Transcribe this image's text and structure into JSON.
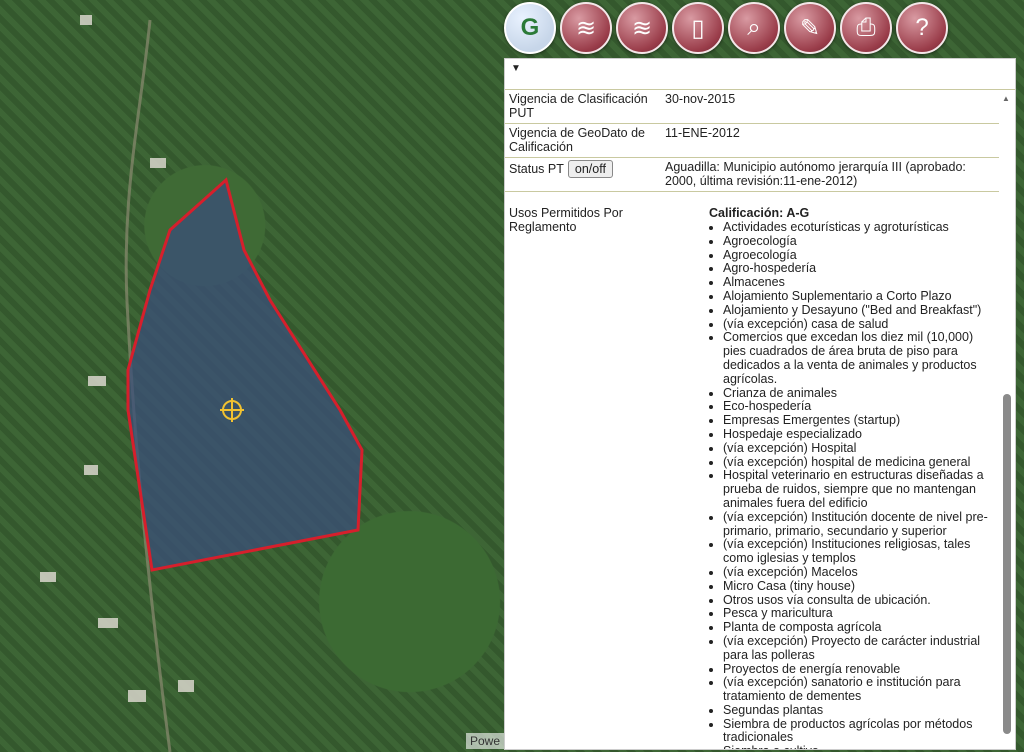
{
  "toolbar": {
    "items": [
      {
        "name": "google-maps-icon",
        "glyph": "G"
      },
      {
        "name": "layers-icon",
        "glyph": "≋"
      },
      {
        "name": "layers-stack-icon",
        "glyph": "≋"
      },
      {
        "name": "mobile-icon",
        "glyph": "▯"
      },
      {
        "name": "search-icon",
        "glyph": "⌕"
      },
      {
        "name": "edit-icon",
        "glyph": "✎"
      },
      {
        "name": "print-icon",
        "glyph": "⎙"
      },
      {
        "name": "help-icon",
        "glyph": "?"
      }
    ]
  },
  "panel": {
    "caret": "▼",
    "rows": [
      {
        "label": "Vigencia de Clasificación PUT",
        "value": "30-nov-2015"
      },
      {
        "label": "Vigencia de GeoDato de Calificación",
        "value": "11-ENE-2012"
      }
    ],
    "status": {
      "label": "Status PT",
      "button": "on/off",
      "value": "Aguadilla: Municipio autónomo jerarquía III (aprobado: 2000, última revisión:11-ene-2012)"
    },
    "usos": {
      "label": "Usos Permitidos Por Reglamento",
      "heading": "Calificación: A-G",
      "items": [
        "Actividades ecoturísticas y agroturísticas",
        "Agroecología",
        "Agroecología",
        "Agro-hospedería",
        "Almacenes",
        "Alojamiento Suplementario a Corto Plazo",
        "Alojamiento y Desayuno (\"Bed and Breakfast\")",
        "(vía excepción) casa de salud",
        "Comercios que excedan los diez mil (10,000) pies cuadrados de área bruta de piso para dedicados a la venta de animales y productos agrícolas.",
        "Crianza de animales",
        "Eco-hospedería",
        "Empresas Emergentes (startup)",
        "Hospedaje especializado",
        "(vía excepción) Hospital",
        "(vía excepción) hospital de medicina general",
        "Hospital veterinario en estructuras diseñadas a prueba de ruidos, siempre que no mantengan animales fuera del edificio",
        "(vía excepción) Institución docente de nivel pre-primario, primario, secundario y superior",
        "(vía excepción) Instituciones religiosas, tales como iglesias y templos",
        "(vía excepción) Macelos",
        "Micro Casa (tiny house)",
        "Otros usos vía consulta de ubicación.",
        "Pesca y maricultura",
        "Planta de composta agrícola",
        "(vía excepción) Proyecto de carácter industrial para las polleras",
        "Proyectos de energía renovable",
        "(vía excepción) sanatorio e institución para tratamiento de dementes",
        "Segundas plantas",
        "Siembra de productos agrícolas por métodos tradicionales",
        "Siembra o cultivo"
      ]
    },
    "scroll_up": "▲"
  },
  "map": {
    "attribution": "Powe"
  },
  "colors": {
    "parcel_fill": "#3b4f7a",
    "parcel_stroke": "#d61f2c",
    "marker": "#f2c230"
  }
}
